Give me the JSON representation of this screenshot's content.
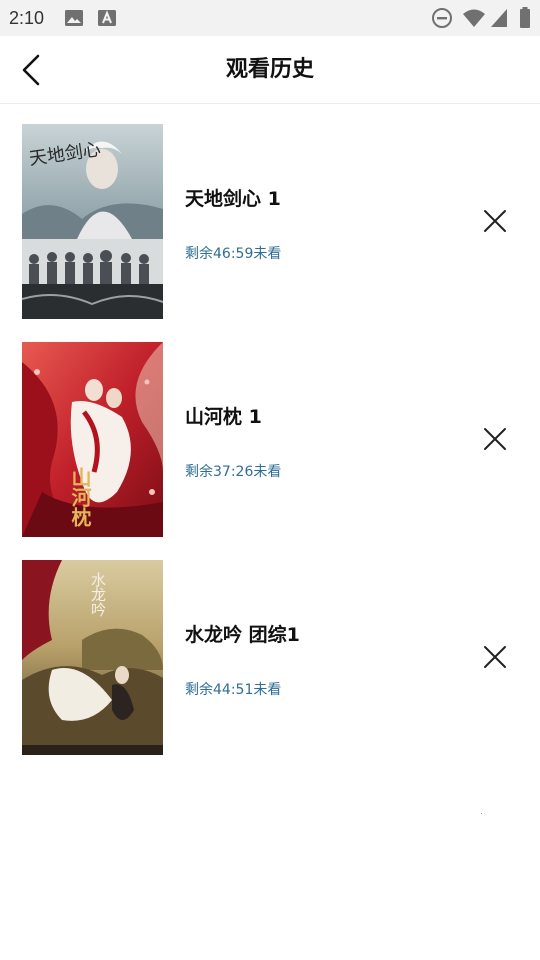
{
  "status_bar": {
    "time": "2:10",
    "icons": [
      "gallery-icon",
      "a-text-icon",
      "do-not-disturb-icon",
      "wifi-icon",
      "signal-icon",
      "battery-icon"
    ]
  },
  "header": {
    "title": "观看历史",
    "back_icon": "chevron-left-icon"
  },
  "history": [
    {
      "title": "天地剑心 1",
      "remaining": "剩余46:59未看",
      "poster_text": "天地剑心",
      "poster_colors": [
        "#8fa3a9",
        "#3a3f44"
      ]
    },
    {
      "title": "山河枕 1",
      "remaining": "剩余37:26未看",
      "poster_text": "山河枕",
      "poster_colors": [
        "#c0202a",
        "#f2d9c8"
      ]
    },
    {
      "title": "水龙吟 团综1",
      "remaining": "剩余44:51未看",
      "poster_text": "水龙吟",
      "poster_colors": [
        "#b8a06a",
        "#4a3a22"
      ]
    }
  ],
  "delete_icon": "close-icon",
  "accent_color": "#2e6e96"
}
